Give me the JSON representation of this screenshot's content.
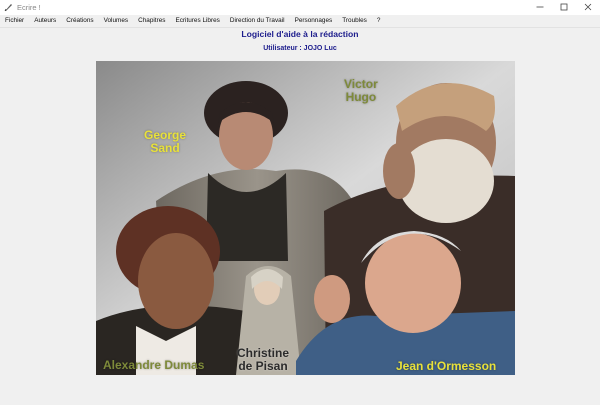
{
  "window": {
    "title": "Ecrire !",
    "icons": {
      "app": "quill-icon",
      "minimize": "minimize-icon",
      "maximize": "maximize-icon",
      "close": "close-icon"
    }
  },
  "menu": [
    "Fichier",
    "Auteurs",
    "Créations",
    "Volumes",
    "Chapitres",
    "Ecritures Libres",
    "Direction du Travail",
    "Personnages",
    "Troubles",
    "?"
  ],
  "app": {
    "heading": "Logiciel d'aide à la rédaction",
    "user_line": "Utilisateur : JOJO Luc"
  },
  "collage": {
    "george_sand": "George\nSand",
    "victor_hugo": "Victor\nHugo",
    "alexandre_dumas": "Alexandre Dumas",
    "christine_de_pisan": "Christine\nde Pisan",
    "jean_dormesson": "Jean d'Ormesson"
  },
  "colors": {
    "heading": "#1c1c8c",
    "caption_yellow": "#e8e13a",
    "caption_olive": "#7e8a3a"
  }
}
